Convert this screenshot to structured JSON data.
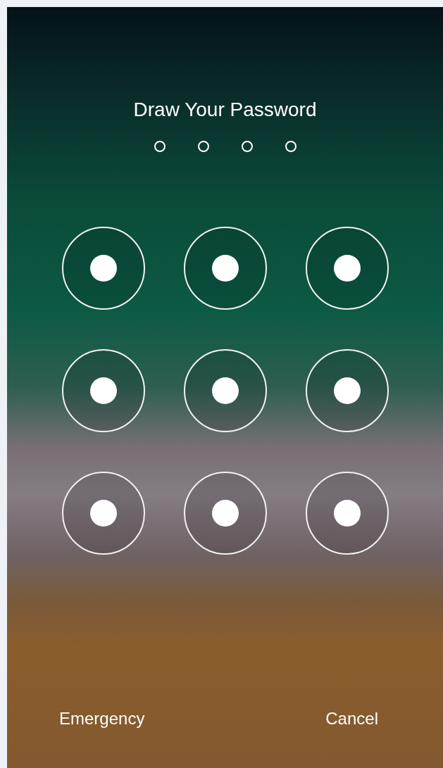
{
  "title": "Draw Your Password",
  "passcode_dots": [
    {
      "filled": false
    },
    {
      "filled": false
    },
    {
      "filled": false
    },
    {
      "filled": false
    }
  ],
  "pattern_nodes": [
    {
      "selected": false
    },
    {
      "selected": false
    },
    {
      "selected": false
    },
    {
      "selected": false
    },
    {
      "selected": false
    },
    {
      "selected": false
    },
    {
      "selected": false
    },
    {
      "selected": false
    },
    {
      "selected": false
    }
  ],
  "buttons": [
    {
      "label": "Emergency"
    },
    {
      "label": "Cancel"
    }
  ]
}
